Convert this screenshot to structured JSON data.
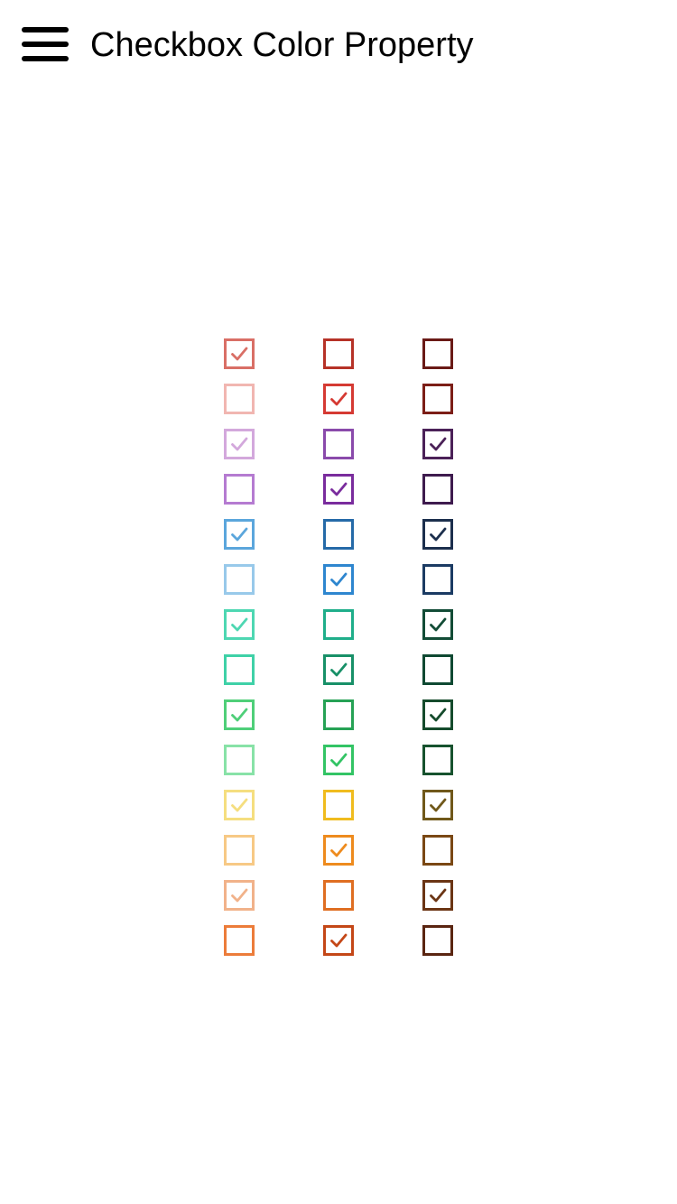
{
  "header": {
    "title": "Checkbox Color Property",
    "menu_icon": "hamburger-menu-icon"
  },
  "checkbox_grid": {
    "check_icon": "checkmark-icon",
    "columns": [
      {
        "items": [
          {
            "color": "#d96f66",
            "checked": true
          },
          {
            "color": "#f1b6b1",
            "checked": false
          },
          {
            "color": "#d3a8dc",
            "checked": true
          },
          {
            "color": "#b57bd1",
            "checked": false
          },
          {
            "color": "#5ba6dc",
            "checked": true
          },
          {
            "color": "#98c9ea",
            "checked": false
          },
          {
            "color": "#4ed7b2",
            "checked": true
          },
          {
            "color": "#3fd1a7",
            "checked": false
          },
          {
            "color": "#4fcf79",
            "checked": true
          },
          {
            "color": "#88e2a7",
            "checked": false
          },
          {
            "color": "#f5de7f",
            "checked": true
          },
          {
            "color": "#f7c985",
            "checked": false
          },
          {
            "color": "#f1b28a",
            "checked": true
          },
          {
            "color": "#ec7c3a",
            "checked": false
          }
        ]
      },
      {
        "items": [
          {
            "color": "#b63227",
            "checked": false
          },
          {
            "color": "#d53a33",
            "checked": true
          },
          {
            "color": "#8a4aab",
            "checked": false
          },
          {
            "color": "#7a2c9d",
            "checked": true
          },
          {
            "color": "#256aa8",
            "checked": false
          },
          {
            "color": "#2e86cf",
            "checked": true
          },
          {
            "color": "#1fae8a",
            "checked": false
          },
          {
            "color": "#189068",
            "checked": true
          },
          {
            "color": "#26a255",
            "checked": false
          },
          {
            "color": "#33c465",
            "checked": true
          },
          {
            "color": "#f0bc1e",
            "checked": false
          },
          {
            "color": "#ee8b1e",
            "checked": true
          },
          {
            "color": "#df6e22",
            "checked": false
          },
          {
            "color": "#c44717",
            "checked": true
          }
        ]
      },
      {
        "items": [
          {
            "color": "#6a1a16",
            "checked": false
          },
          {
            "color": "#7c1e17",
            "checked": false
          },
          {
            "color": "#4b2158",
            "checked": true
          },
          {
            "color": "#3e1b4e",
            "checked": false
          },
          {
            "color": "#1c2f4d",
            "checked": true
          },
          {
            "color": "#1b3b63",
            "checked": false
          },
          {
            "color": "#124c36",
            "checked": true
          },
          {
            "color": "#0f4932",
            "checked": false
          },
          {
            "color": "#154b2c",
            "checked": true
          },
          {
            "color": "#17522e",
            "checked": false
          },
          {
            "color": "#70581a",
            "checked": true
          },
          {
            "color": "#7a4814",
            "checked": false
          },
          {
            "color": "#6b3514",
            "checked": true
          },
          {
            "color": "#5a2511",
            "checked": false
          }
        ]
      }
    ]
  }
}
